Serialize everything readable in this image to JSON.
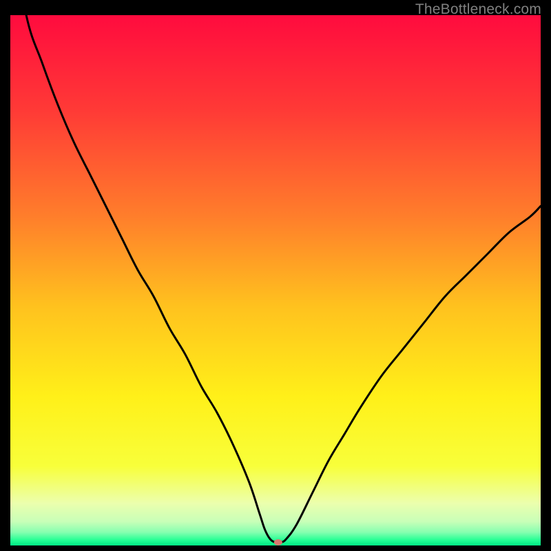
{
  "watermark": "TheBottleneck.com",
  "chart_data": {
    "type": "line",
    "title": "",
    "xlabel": "",
    "ylabel": "",
    "xlim": [
      0,
      100
    ],
    "ylim": [
      0,
      100
    ],
    "x": [
      0,
      3,
      6,
      9,
      12,
      15,
      18,
      21,
      24,
      27,
      30,
      33,
      36,
      39,
      42,
      45,
      47,
      48,
      49,
      50,
      51,
      52,
      54,
      57,
      60,
      63,
      66,
      70,
      74,
      78,
      82,
      86,
      90,
      94,
      98,
      100
    ],
    "values": [
      118,
      100,
      91,
      83,
      76,
      70,
      64,
      58,
      52,
      47,
      41,
      36,
      30,
      25,
      19,
      12,
      6,
      3,
      1.2,
      0.6,
      0.6,
      1.2,
      4,
      10,
      16,
      21,
      26,
      32,
      37,
      42,
      47,
      51,
      55,
      59,
      62,
      64
    ],
    "min_marker": {
      "x": 50.5,
      "y": 0.6
    },
    "gradient_stops": [
      {
        "pos": 0.0,
        "color": "#ff0b3e"
      },
      {
        "pos": 0.18,
        "color": "#ff3a36"
      },
      {
        "pos": 0.38,
        "color": "#ff7e2b"
      },
      {
        "pos": 0.55,
        "color": "#ffc21e"
      },
      {
        "pos": 0.72,
        "color": "#fff019"
      },
      {
        "pos": 0.85,
        "color": "#f8ff3a"
      },
      {
        "pos": 0.92,
        "color": "#ecffad"
      },
      {
        "pos": 0.955,
        "color": "#c8ffb8"
      },
      {
        "pos": 0.975,
        "color": "#86ffb0"
      },
      {
        "pos": 0.99,
        "color": "#24ff94"
      },
      {
        "pos": 1.0,
        "color": "#00e884"
      }
    ]
  }
}
